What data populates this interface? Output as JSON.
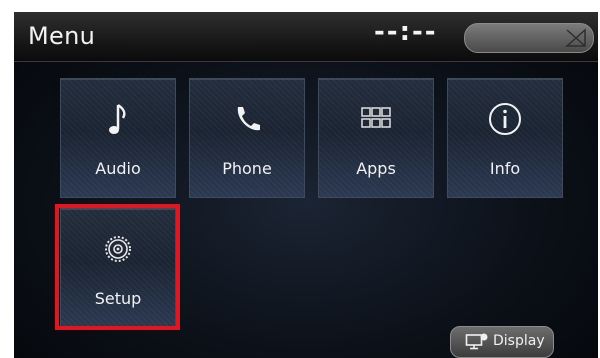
{
  "header": {
    "title": "Menu",
    "clock": "--:--"
  },
  "tiles": [
    {
      "label": "Audio",
      "icon": "music-note-icon"
    },
    {
      "label": "Phone",
      "icon": "phone-icon"
    },
    {
      "label": "Apps",
      "icon": "apps-grid-icon"
    },
    {
      "label": "Info",
      "icon": "info-icon"
    },
    {
      "label": "Setup",
      "icon": "gear-icon"
    }
  ],
  "display_button": {
    "label": "Display",
    "icon": "display-icon"
  },
  "colors": {
    "highlight": "#e5141e",
    "tile_text": "#f2f2f2",
    "background": "#0c1119"
  }
}
